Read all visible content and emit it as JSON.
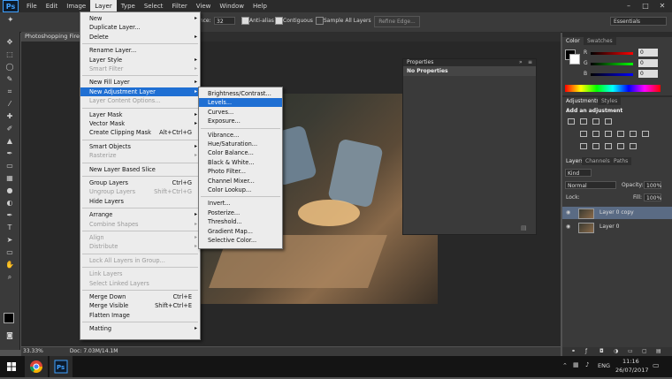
{
  "menubar": {
    "items": [
      "File",
      "Edit",
      "Image",
      "Layer",
      "Type",
      "Select",
      "Filter",
      "View",
      "Window",
      "Help"
    ],
    "active": "Layer"
  },
  "options_bar": {
    "tolerance_label": "erance:",
    "tolerance_value": "32",
    "anti_alias": "Anti-alias",
    "contiguous": "Contiguous",
    "sample_all": "Sample All Layers",
    "refine_edge": "Refine Edge...",
    "workspace": "Essentials"
  },
  "document": {
    "tab_title": "Photoshopping Fire",
    "zoom": "33.33%",
    "doc_size": "Doc: 7.03M/14.1M"
  },
  "layer_menu": [
    {
      "label": "New",
      "arrow": true
    },
    {
      "label": "Duplicate Layer..."
    },
    {
      "label": "Delete",
      "arrow": true
    },
    {
      "sep": true
    },
    {
      "label": "Rename Layer..."
    },
    {
      "label": "Layer Style",
      "arrow": true
    },
    {
      "label": "Smart Filter",
      "arrow": true,
      "disabled": true
    },
    {
      "sep": true
    },
    {
      "label": "New Fill Layer",
      "arrow": true
    },
    {
      "label": "New Adjustment Layer",
      "arrow": true,
      "highlight": true
    },
    {
      "label": "Layer Content Options...",
      "disabled": true
    },
    {
      "sep": true
    },
    {
      "label": "Layer Mask",
      "arrow": true
    },
    {
      "label": "Vector Mask",
      "arrow": true
    },
    {
      "label": "Create Clipping Mask",
      "shortcut": "Alt+Ctrl+G"
    },
    {
      "sep": true
    },
    {
      "label": "Smart Objects",
      "arrow": true
    },
    {
      "label": "Rasterize",
      "arrow": true,
      "disabled": true
    },
    {
      "sep": true
    },
    {
      "label": "New Layer Based Slice"
    },
    {
      "sep": true
    },
    {
      "label": "Group Layers",
      "shortcut": "Ctrl+G"
    },
    {
      "label": "Ungroup Layers",
      "shortcut": "Shift+Ctrl+G",
      "disabled": true
    },
    {
      "label": "Hide Layers"
    },
    {
      "sep": true
    },
    {
      "label": "Arrange",
      "arrow": true
    },
    {
      "label": "Combine Shapes",
      "arrow": true,
      "disabled": true
    },
    {
      "sep": true
    },
    {
      "label": "Align",
      "arrow": true,
      "disabled": true
    },
    {
      "label": "Distribute",
      "arrow": true,
      "disabled": true
    },
    {
      "sep": true
    },
    {
      "label": "Lock All Layers in Group...",
      "disabled": true
    },
    {
      "sep": true
    },
    {
      "label": "Link Layers",
      "disabled": true
    },
    {
      "label": "Select Linked Layers",
      "disabled": true
    },
    {
      "sep": true
    },
    {
      "label": "Merge Down",
      "shortcut": "Ctrl+E"
    },
    {
      "label": "Merge Visible",
      "shortcut": "Shift+Ctrl+E"
    },
    {
      "label": "Flatten Image"
    },
    {
      "sep": true
    },
    {
      "label": "Matting",
      "arrow": true
    }
  ],
  "adjustment_submenu": [
    {
      "label": "Brightness/Contrast..."
    },
    {
      "label": "Levels...",
      "highlight": true
    },
    {
      "label": "Curves..."
    },
    {
      "label": "Exposure..."
    },
    {
      "sep": true
    },
    {
      "label": "Vibrance..."
    },
    {
      "label": "Hue/Saturation..."
    },
    {
      "label": "Color Balance..."
    },
    {
      "label": "Black & White..."
    },
    {
      "label": "Photo Filter..."
    },
    {
      "label": "Channel Mixer..."
    },
    {
      "label": "Color Lookup..."
    },
    {
      "sep": true
    },
    {
      "label": "Invert..."
    },
    {
      "label": "Posterize..."
    },
    {
      "label": "Threshold..."
    },
    {
      "label": "Gradient Map..."
    },
    {
      "label": "Selective Color..."
    }
  ],
  "properties": {
    "title": "Properties",
    "content": "No Properties"
  },
  "color_panel": {
    "tabs": [
      "Color",
      "Swatches"
    ],
    "channels": [
      {
        "label": "R",
        "value": "0"
      },
      {
        "label": "G",
        "value": "0"
      },
      {
        "label": "B",
        "value": "0"
      }
    ]
  },
  "adjustments_panel": {
    "tabs": [
      "Adjustments",
      "Styles"
    ],
    "heading": "Add an adjustment"
  },
  "layers_panel": {
    "tabs": [
      "Layers",
      "Channels",
      "Paths"
    ],
    "kind": "Kind",
    "blend_mode": "Normal",
    "opacity_label": "Opacity:",
    "opacity_value": "100%",
    "lock_label": "Lock:",
    "fill_label": "Fill:",
    "fill_value": "100%",
    "layers": [
      {
        "name": "Layer 0 copy",
        "selected": true
      },
      {
        "name": "Layer 0",
        "selected": false
      }
    ]
  },
  "taskbar": {
    "time": "11:16",
    "date": "26/07/2017",
    "lang": "ENG"
  }
}
